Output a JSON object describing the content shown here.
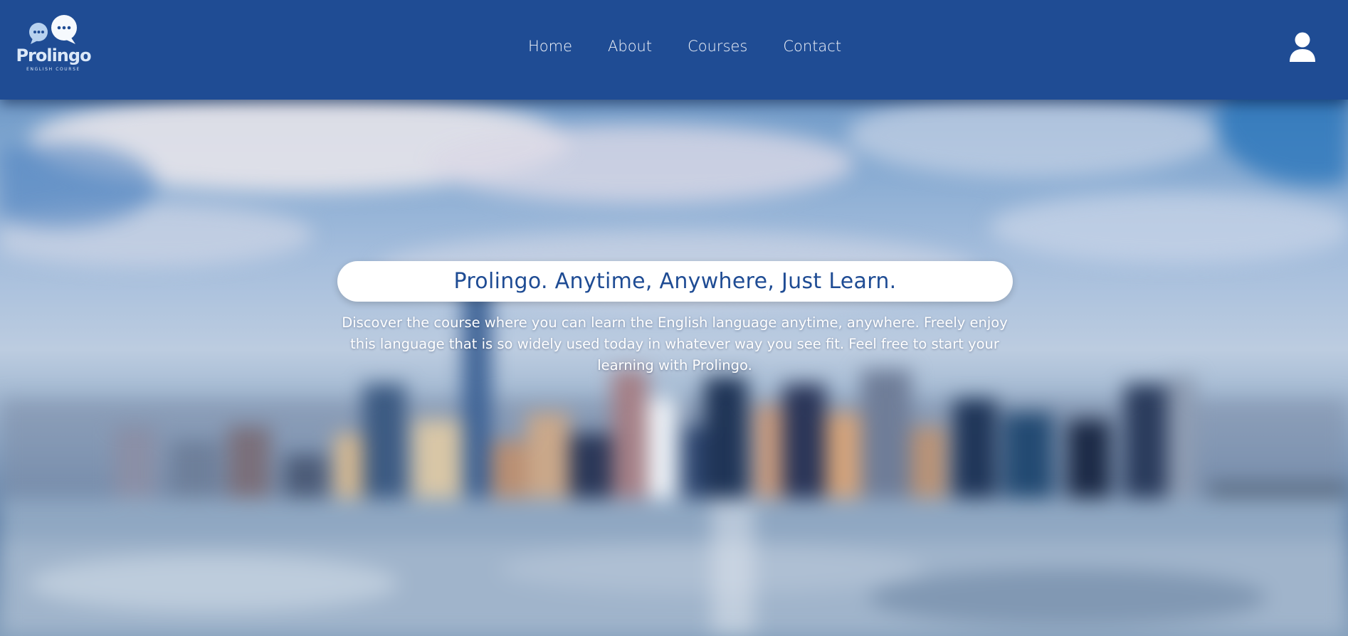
{
  "brand": {
    "name": "Prolingo",
    "tagline": "ENGLISH COURSE",
    "logo_icon": "speech-bubbles-icon"
  },
  "nav": {
    "items": [
      {
        "label": "Home"
      },
      {
        "label": "About"
      },
      {
        "label": "Courses"
      },
      {
        "label": "Contact"
      }
    ]
  },
  "header": {
    "user_icon": "user-icon"
  },
  "hero": {
    "title": "Prolingo. Anytime, Anywhere, Just Learn.",
    "description": "Discover the course where you can learn the English language anytime, anywhere. Freely enjoy this language that is so widely used today in whatever way you see fit. Feel free to start your learning with Prolingo."
  },
  "colors": {
    "header_bg": "#1f4c94",
    "accent": "#1f4c94",
    "logo_light": "#dbe8f8",
    "title_box_bg": "#ffffff",
    "text_light": "#ffffff"
  }
}
